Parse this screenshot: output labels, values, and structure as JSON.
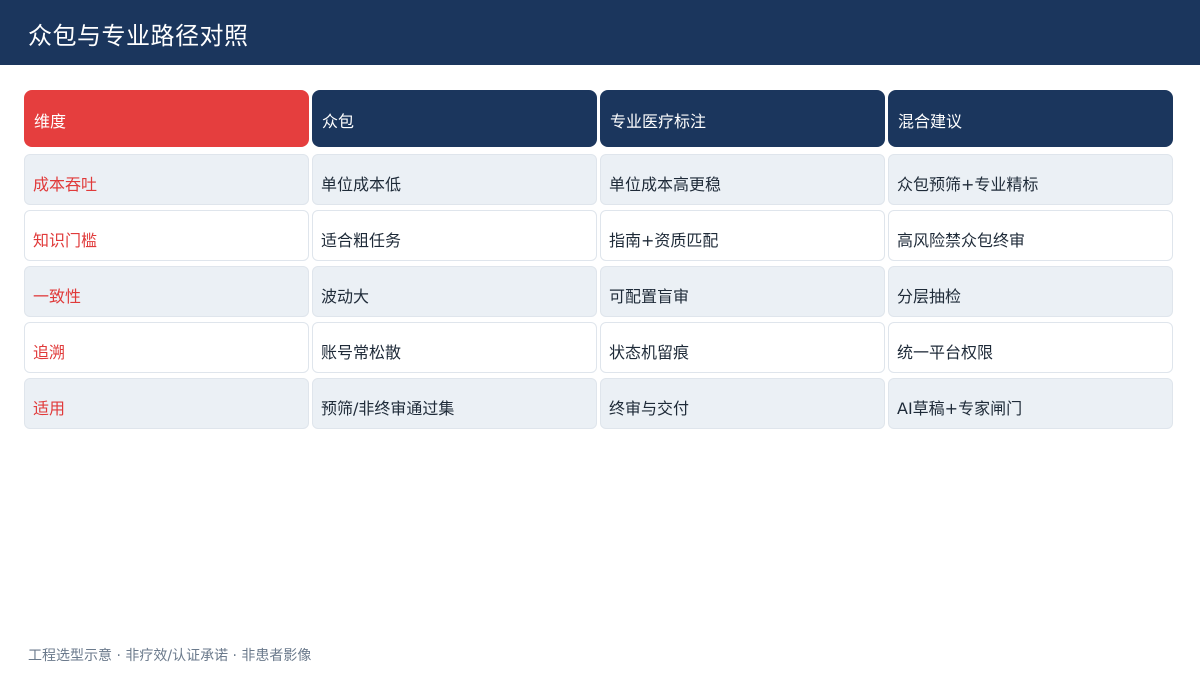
{
  "header": {
    "title": "众包与专业路径对照"
  },
  "table": {
    "columns": [
      "维度",
      "众包",
      "专业医疗标注",
      "混合建议"
    ],
    "rows": [
      [
        "成本吞吐",
        "单位成本低",
        "单位成本高更稳",
        "众包预筛+专业精标"
      ],
      [
        "知识门槛",
        "适合粗任务",
        "指南+资质匹配",
        "高风险禁众包终审"
      ],
      [
        "一致性",
        "波动大",
        "可配置盲审",
        "分层抽检"
      ],
      [
        "追溯",
        "账号常松散",
        "状态机留痕",
        "统一平台权限"
      ],
      [
        "适用",
        "预筛/非终审通过集",
        "终审与交付",
        "AI草稿+专家闸门"
      ]
    ]
  },
  "footer": {
    "note": "工程选型示意 · 非疗效/认证承诺 · 非患者影像"
  },
  "colors": {
    "header_bg": "#1b365d",
    "accent_red": "#e53e3e",
    "row_shade": "#ebf0f5"
  }
}
